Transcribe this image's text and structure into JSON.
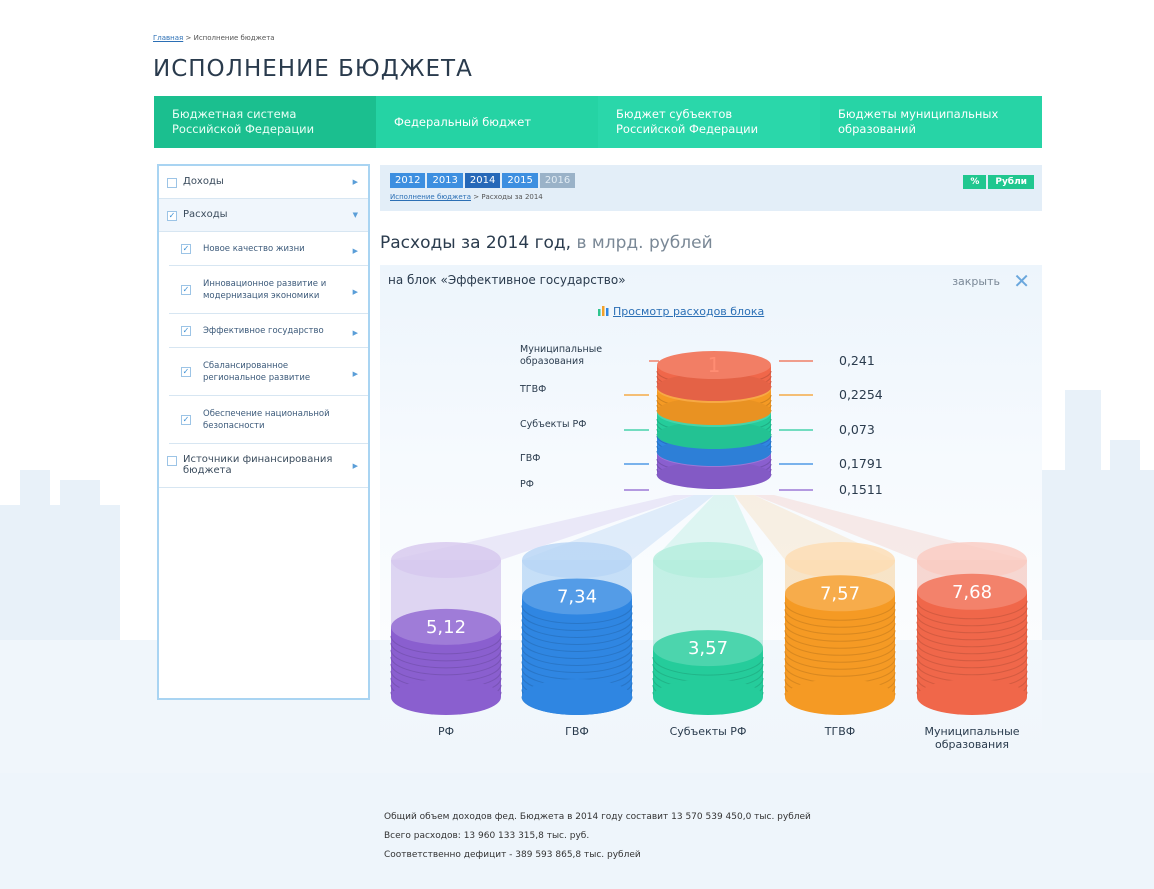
{
  "breadcrumb": {
    "home": "Главная",
    "sep": ">",
    "current": "Исполнение бюджета"
  },
  "page_title": "ИСПОЛНЕНИЕ БЮДЖЕТА",
  "topnav": [
    {
      "line1": "Бюджетная система",
      "line2": "Российской Федерации"
    },
    {
      "line1": "Федеральный бюджет",
      "line2": ""
    },
    {
      "line1": "Бюджет субъектов",
      "line2": "Российской Федерации"
    },
    {
      "line1": "Бюджеты муниципальных",
      "line2": "образований"
    }
  ],
  "sidebar": {
    "items": [
      {
        "label": "Доходы",
        "checked": false
      },
      {
        "label": "Расходы",
        "checked": true
      },
      {
        "label": "Новое качество жизни",
        "checked": true
      },
      {
        "label": "Инновационное развитие и модернизация экономики",
        "checked": true
      },
      {
        "label": "Эффективное государство",
        "checked": true
      },
      {
        "label": "Сбалансированное региональное развитие",
        "checked": true
      },
      {
        "label": "Обеспечение национальной безопасности",
        "checked": true
      },
      {
        "label": "Источники финансирования бюджета",
        "checked": false
      }
    ]
  },
  "toolbar": {
    "years": [
      "2012",
      "2013",
      "2014",
      "2015",
      "2016"
    ],
    "selected_year": "2014",
    "sub_crumb_link": "Исполнение бюджета",
    "sub_crumb_current": "Расходы за 2014",
    "units": [
      "%",
      "Рубли"
    ]
  },
  "chart_heading": {
    "main": "Расходы за 2014 год,",
    "unit": " в млрд. рублей"
  },
  "block": {
    "label": "на блок «Эффективное государство»",
    "close_label": "закрыть",
    "view_link": "Просмотр расходов блока"
  },
  "colors": {
    "rf": "#8a5fcf",
    "gvf": "#2f86e2",
    "subjects": "#25cc9b",
    "tgvf": "#f59a24",
    "municipal": "#f0674a",
    "accent_green": "#25d3a4"
  },
  "chart_data": [
    {
      "type": "bar",
      "title": "",
      "categories": [
        "Муниципальные образования",
        "ТГВФ",
        "Субъекты РФ",
        "ГВФ",
        "РФ"
      ],
      "values": [
        0.241,
        0.2254,
        0.073,
        0.1791,
        0.1511
      ],
      "value_labels": [
        "0,241",
        "0,2254",
        "0,073",
        "0,1791",
        "0,1511"
      ],
      "stack_label": "1"
    },
    {
      "type": "bar",
      "title": "",
      "categories": [
        "РФ",
        "ГВФ",
        "Субъекты РФ",
        "ТГВФ",
        "Муниципальные образования"
      ],
      "values": [
        5.12,
        7.34,
        3.57,
        7.57,
        7.68
      ],
      "value_labels": [
        "5,12",
        "7,34",
        "3,57",
        "7,57",
        "7,68"
      ],
      "category_lines": [
        [
          "РФ"
        ],
        [
          "ГВФ"
        ],
        [
          "Субъекты РФ"
        ],
        [
          "ТГВФ"
        ],
        [
          "Муниципальные",
          "образования"
        ]
      ]
    }
  ],
  "totals": [
    "Общий объем доходов фед. Бюджета  в 2014 году составит 13 570 539 450,0 тыс. рублей",
    "Всего расходов: 13 960 133 315,8 тыс. руб.",
    "Соответственно дефицит - 389 593 865,8 тыс. рублей"
  ]
}
